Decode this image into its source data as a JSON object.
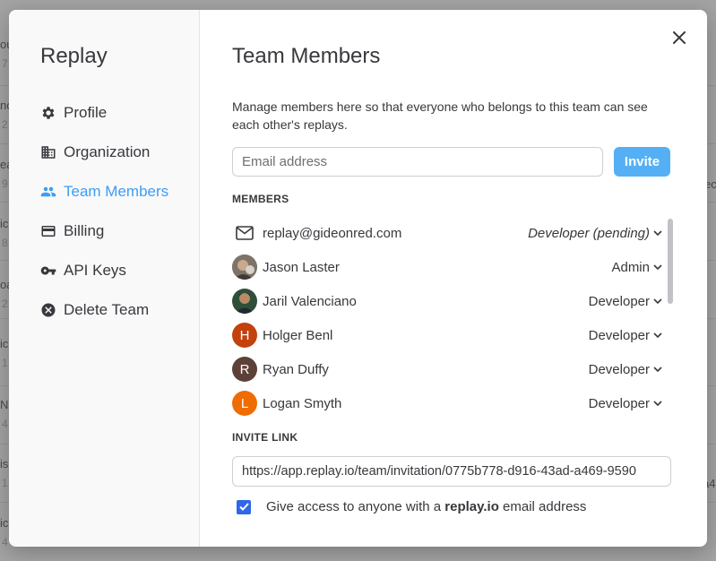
{
  "background": {
    "fragments": [
      {
        "text": "ou"
      },
      {
        "text": "7"
      },
      {
        "text": "no"
      },
      {
        "text": "2"
      },
      {
        "text": "ea"
      },
      {
        "text": "9"
      },
      {
        "text": "ic"
      },
      {
        "text": "8"
      },
      {
        "text": "oa"
      },
      {
        "text": "2"
      },
      {
        "text": "ic"
      },
      {
        "text": "1"
      },
      {
        "text": "No"
      },
      {
        "text": "4"
      },
      {
        "text": "is"
      },
      {
        "text": "1"
      },
      {
        "text": "ic"
      },
      {
        "text": "4"
      },
      {
        "text": "ec"
      },
      {
        "text": "a4"
      }
    ]
  },
  "sidebar": {
    "title": "Replay",
    "items": [
      {
        "label": "Profile",
        "icon": "gear-icon",
        "active": false
      },
      {
        "label": "Organization",
        "icon": "building-icon",
        "active": false
      },
      {
        "label": "Team Members",
        "icon": "people-icon",
        "active": true
      },
      {
        "label": "Billing",
        "icon": "credit-card-icon",
        "active": false
      },
      {
        "label": "API Keys",
        "icon": "key-icon",
        "active": false
      },
      {
        "label": "Delete Team",
        "icon": "x-circle-icon",
        "active": false
      }
    ]
  },
  "main": {
    "title": "Team Members",
    "description": "Manage members here so that everyone who belongs to this team can see each other's replays.",
    "email_placeholder": "Email address",
    "invite_label": "Invite",
    "members_label": "MEMBERS",
    "members": [
      {
        "name": "replay@gideonred.com",
        "role": "Developer (pending)",
        "avatar_type": "mail",
        "initial": "",
        "color": ""
      },
      {
        "name": "Jason Laster",
        "role": "Admin",
        "avatar_type": "photo",
        "initial": "",
        "color": "#6b6258"
      },
      {
        "name": "Jaril Valenciano",
        "role": "Developer",
        "avatar_type": "photo",
        "initial": "",
        "color": "#2f4f3a"
      },
      {
        "name": "Holger Benl",
        "role": "Developer",
        "avatar_type": "initial",
        "initial": "H",
        "color": "#c2410c"
      },
      {
        "name": "Ryan Duffy",
        "role": "Developer",
        "avatar_type": "initial",
        "initial": "R",
        "color": "#5d4037"
      },
      {
        "name": "Logan Smyth",
        "role": "Developer",
        "avatar_type": "initial",
        "initial": "L",
        "color": "#ef6c00"
      }
    ],
    "invite_link_label": "INVITE LINK",
    "invite_link": "https://app.replay.io/team/invitation/0775b778-d916-43ad-a469-9590",
    "checkbox_prefix": "Give access to anyone with a ",
    "checkbox_domain": "replay.io",
    "checkbox_suffix": " email address",
    "checkbox_checked": true
  },
  "colors": {
    "accent": "#3d9df2",
    "invite_button": "#54aff5",
    "checkbox": "#2e67e8"
  }
}
